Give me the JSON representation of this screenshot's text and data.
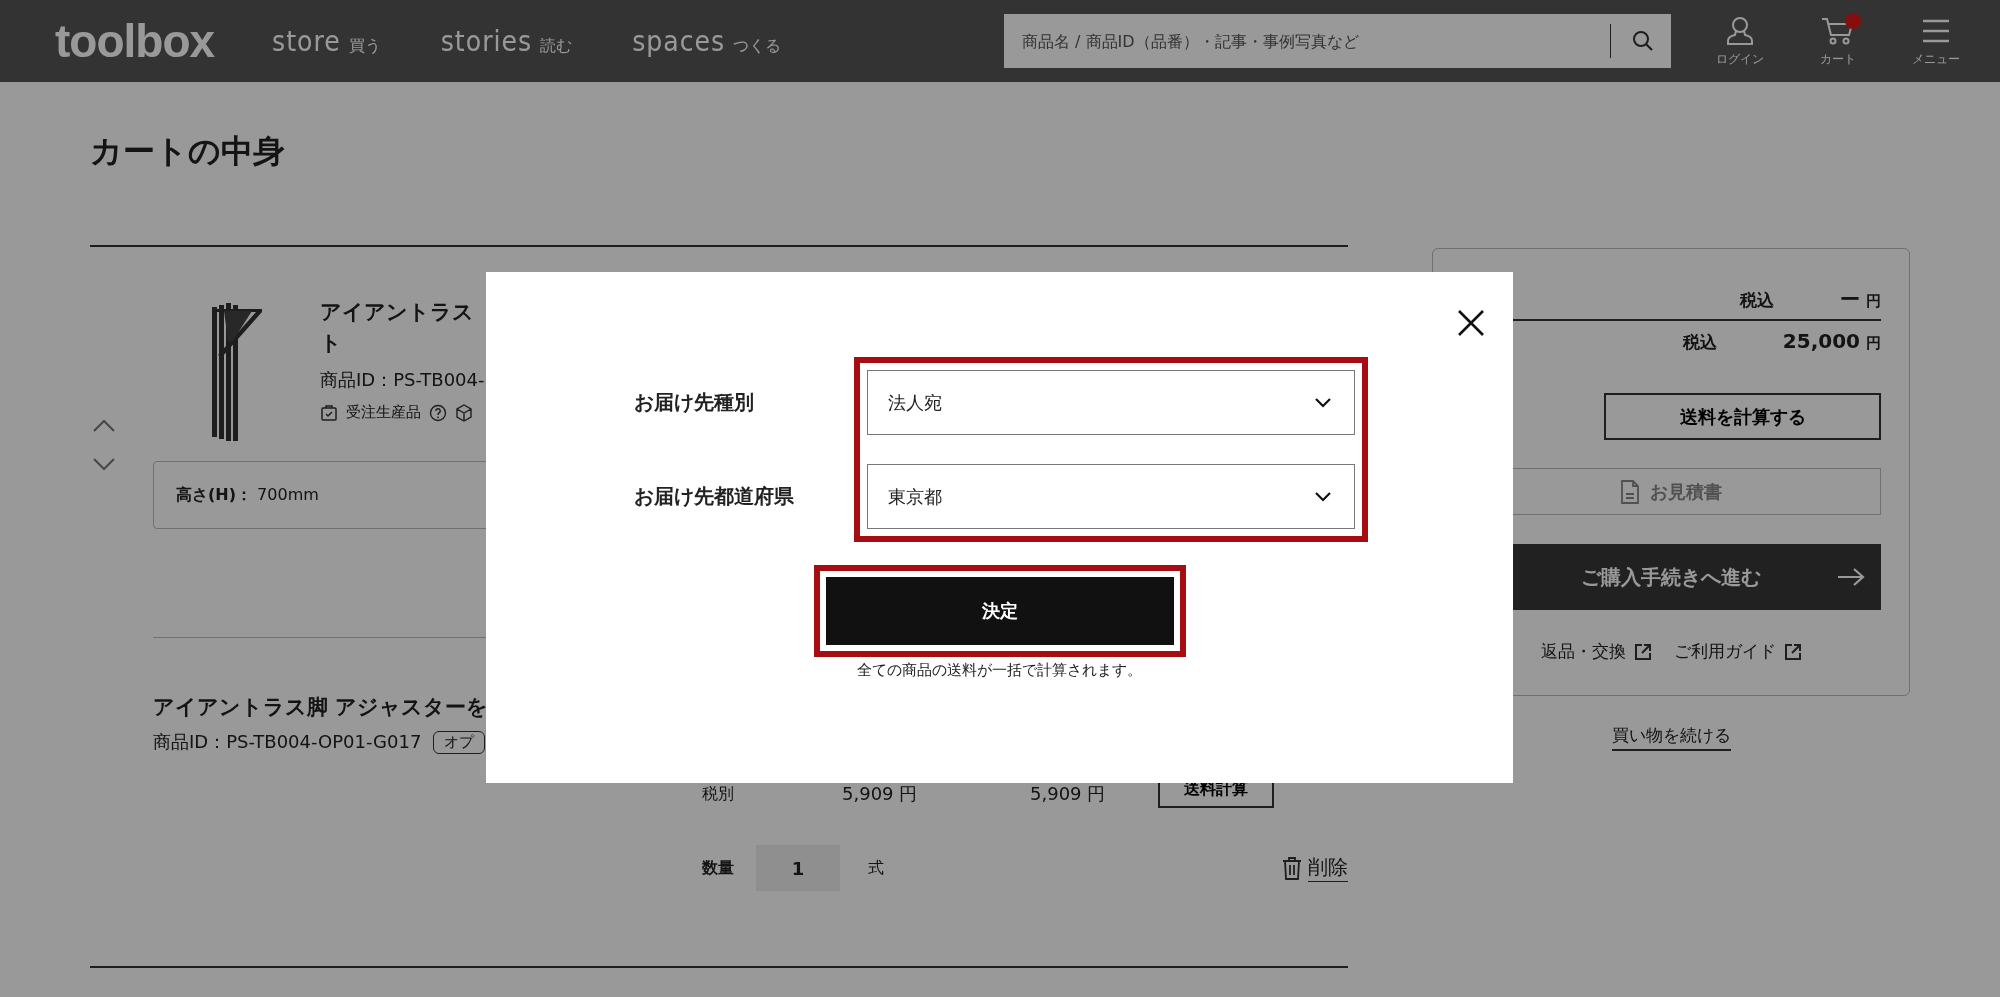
{
  "header": {
    "logo": "toolbox",
    "nav": [
      {
        "label": "store",
        "sub": "買う"
      },
      {
        "label": "stories",
        "sub": "読む"
      },
      {
        "label": "spaces",
        "sub": "つくる"
      }
    ],
    "search": {
      "placeholder": "商品名 / 商品ID（品番）・記事・事例写真など"
    },
    "actions": [
      {
        "kind": "user",
        "label": "ログイン",
        "notification": false
      },
      {
        "kind": "cart",
        "label": "カート",
        "notification": true
      },
      {
        "kind": "menu",
        "label": "メニュー",
        "notification": false
      }
    ]
  },
  "page_title": "カートの中身",
  "item_1": {
    "kind": "picture",
    "title_lines": [
      "アイアントラス",
      "ト"
    ],
    "product_id": "商品ID：PS-TB004-",
    "tag": "受注生産品",
    "spec_label": "高さ(H)：",
    "spec_value": "700mm"
  },
  "item_2": {
    "title": "アイアントラス脚 アジャスターを",
    "product_id": "商品ID：PS-TB004-OP01-G017",
    "tag": "オプ",
    "tax_label": "税別",
    "unit_price": "5,909 円",
    "subtotal": "5,909 円",
    "shipping_button": "送料計算",
    "qty_label": "数量",
    "qty": "1",
    "unit": "式",
    "delete": "削除"
  },
  "summary": {
    "rows": [
      {
        "label": "税込",
        "value": "ー",
        "unit": "円"
      },
      {
        "label": "税込",
        "value": "25,000",
        "unit": "円"
      }
    ],
    "calc_button": "送料を計算する",
    "quote_button": {
      "label": "お見積書",
      "disabled": true
    },
    "checkout_button": "ご購入手続きへ進む",
    "links": [
      "返品・交換",
      "ご利用ガイド"
    ],
    "continue_link": "買い物を続ける"
  },
  "modal": {
    "highlighted": true,
    "fields": [
      {
        "label": "お届け先種別",
        "value": "法人宛"
      },
      {
        "label": "お届け先都道府県",
        "value": "東京都"
      }
    ],
    "confirm": {
      "label": "決定",
      "highlighted": true
    },
    "note": "全ての商品の送料が一括で計算されます。"
  }
}
